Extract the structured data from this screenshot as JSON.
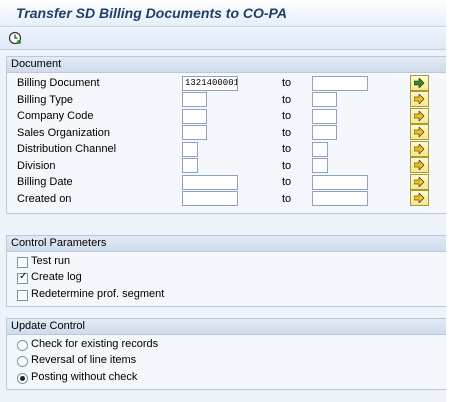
{
  "title": "Transfer SD Billing Documents to CO-PA",
  "toolbar": {
    "execute_icon": "execute-clock-icon"
  },
  "document_group": {
    "title": "Document",
    "to_label": "to",
    "rows": [
      {
        "label": "Billing Document",
        "from": "1321400001",
        "to": ""
      },
      {
        "label": "Billing Type",
        "from": "",
        "to": ""
      },
      {
        "label": "Company Code",
        "from": "",
        "to": ""
      },
      {
        "label": "Sales Organization",
        "from": "",
        "to": ""
      },
      {
        "label": "Distribution Channel",
        "from": "",
        "to": ""
      },
      {
        "label": "Division",
        "from": "",
        "to": ""
      },
      {
        "label": "Billing Date",
        "from": "",
        "to": ""
      },
      {
        "label": "Created on",
        "from": "",
        "to": ""
      }
    ]
  },
  "control_group": {
    "title": "Control Parameters",
    "options": [
      {
        "label": "Test run",
        "checked": false
      },
      {
        "label": "Create log",
        "checked": true
      },
      {
        "label": "Redetermine prof. segment",
        "checked": false
      }
    ]
  },
  "update_group": {
    "title": "Update Control",
    "options": [
      {
        "label": "Check for existing records",
        "selected": false
      },
      {
        "label": "Reversal of line items",
        "selected": false
      },
      {
        "label": "Posting without check",
        "selected": true
      }
    ]
  },
  "colors": {
    "title": "#1f3e6b",
    "frame": "#b9c8dc",
    "button": "#f4e88a"
  }
}
